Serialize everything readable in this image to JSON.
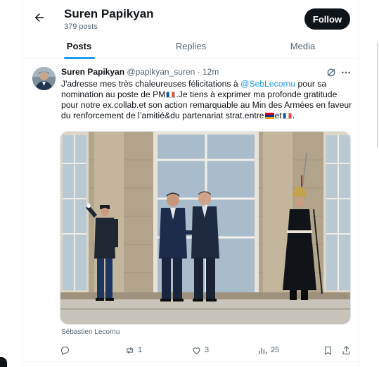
{
  "header": {
    "profile_name": "Suren Papikyan",
    "post_count": "379 posts",
    "follow_label": "Follow"
  },
  "tabs": [
    {
      "label": "Posts",
      "active": true
    },
    {
      "label": "Replies",
      "active": false
    },
    {
      "label": "Media",
      "active": false
    }
  ],
  "post": {
    "author_name": "Suren Papikyan",
    "author_handle": "@papikyan_suren",
    "separator": "·",
    "time": "12m",
    "text_part1": "J'adresse mes très chaleureuses félicitations à ",
    "mention": "@SebLecornu",
    "text_part2": " pour sa nomination au poste de PM",
    "text_part3": ".Je tiens à exprimer ma profonde gratitude pour notre ex.collab.et son action remarquable au Min des Armées en faveur du renforcement de l’amitié&du partenariat strat.entre",
    "text_part4": "et",
    "text_part5": ".",
    "photo_credit": "Sébastien Lecornu"
  },
  "actions": {
    "reply_count": "",
    "repost_count": "1",
    "like_count": "3",
    "views_count": "25"
  },
  "icons": {
    "back": "arrow-left-icon",
    "grok": "grok-icon",
    "more": "more-dots-icon",
    "reply": "reply-icon",
    "repost": "repost-icon",
    "like": "heart-icon",
    "views": "views-icon",
    "bookmark": "bookmark-icon",
    "share": "share-icon"
  },
  "colors": {
    "accent": "#1d9bf0",
    "text": "#0f1419",
    "muted": "#536471",
    "follow_bg": "#0f1419"
  }
}
